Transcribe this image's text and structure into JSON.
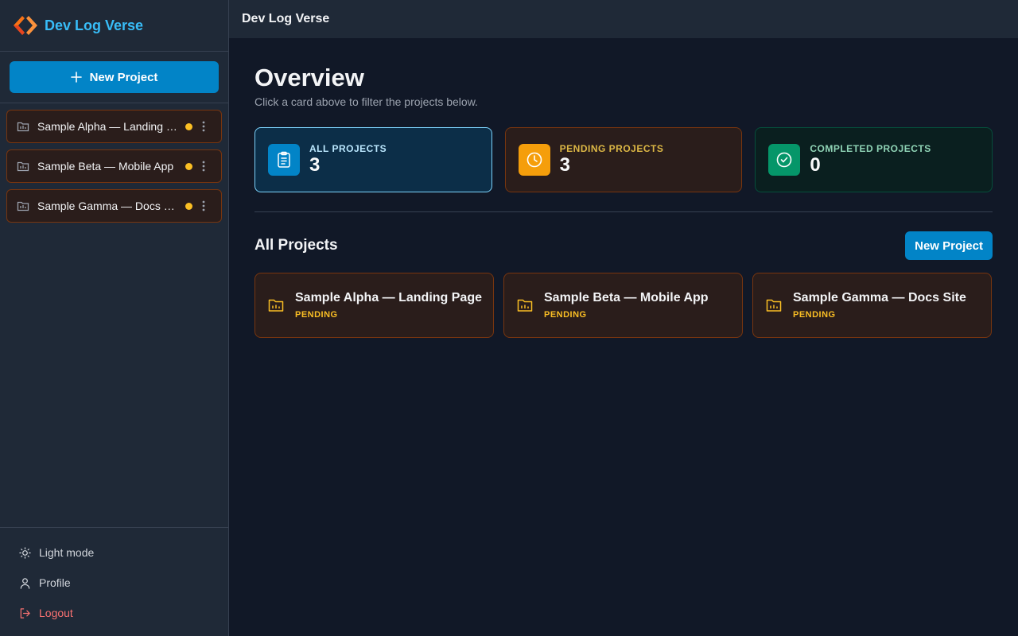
{
  "app": {
    "name": "Dev Log Verse"
  },
  "sidebar": {
    "new_project_label": "New Project",
    "projects": [
      {
        "label": "Sample Alpha — Landing Page"
      },
      {
        "label": "Sample Beta — Mobile App"
      },
      {
        "label": "Sample Gamma — Docs Site"
      }
    ],
    "footer": {
      "light_mode": "Light mode",
      "profile": "Profile",
      "logout": "Logout"
    }
  },
  "topbar": {
    "title": "Dev Log Verse"
  },
  "overview": {
    "title": "Overview",
    "subtitle": "Click a card above to filter the projects below."
  },
  "stats": {
    "all": {
      "label": "ALL PROJECTS",
      "value": "3"
    },
    "pending": {
      "label": "PENDING PROJECTS",
      "value": "3"
    },
    "completed": {
      "label": "COMPLETED PROJECTS",
      "value": "0"
    }
  },
  "projects_section": {
    "title": "All Projects",
    "new_project_label": "New Project",
    "cards": [
      {
        "name": "Sample Alpha — Landing Page",
        "status": "PENDING"
      },
      {
        "name": "Sample Beta — Mobile App",
        "status": "PENDING"
      },
      {
        "name": "Sample Gamma — Docs Site",
        "status": "PENDING"
      }
    ]
  },
  "colors": {
    "accent": "#0284c7",
    "brand": "#38bdf8",
    "pending": "#fbbf24",
    "completed": "#059669",
    "logout": "#f87171"
  }
}
